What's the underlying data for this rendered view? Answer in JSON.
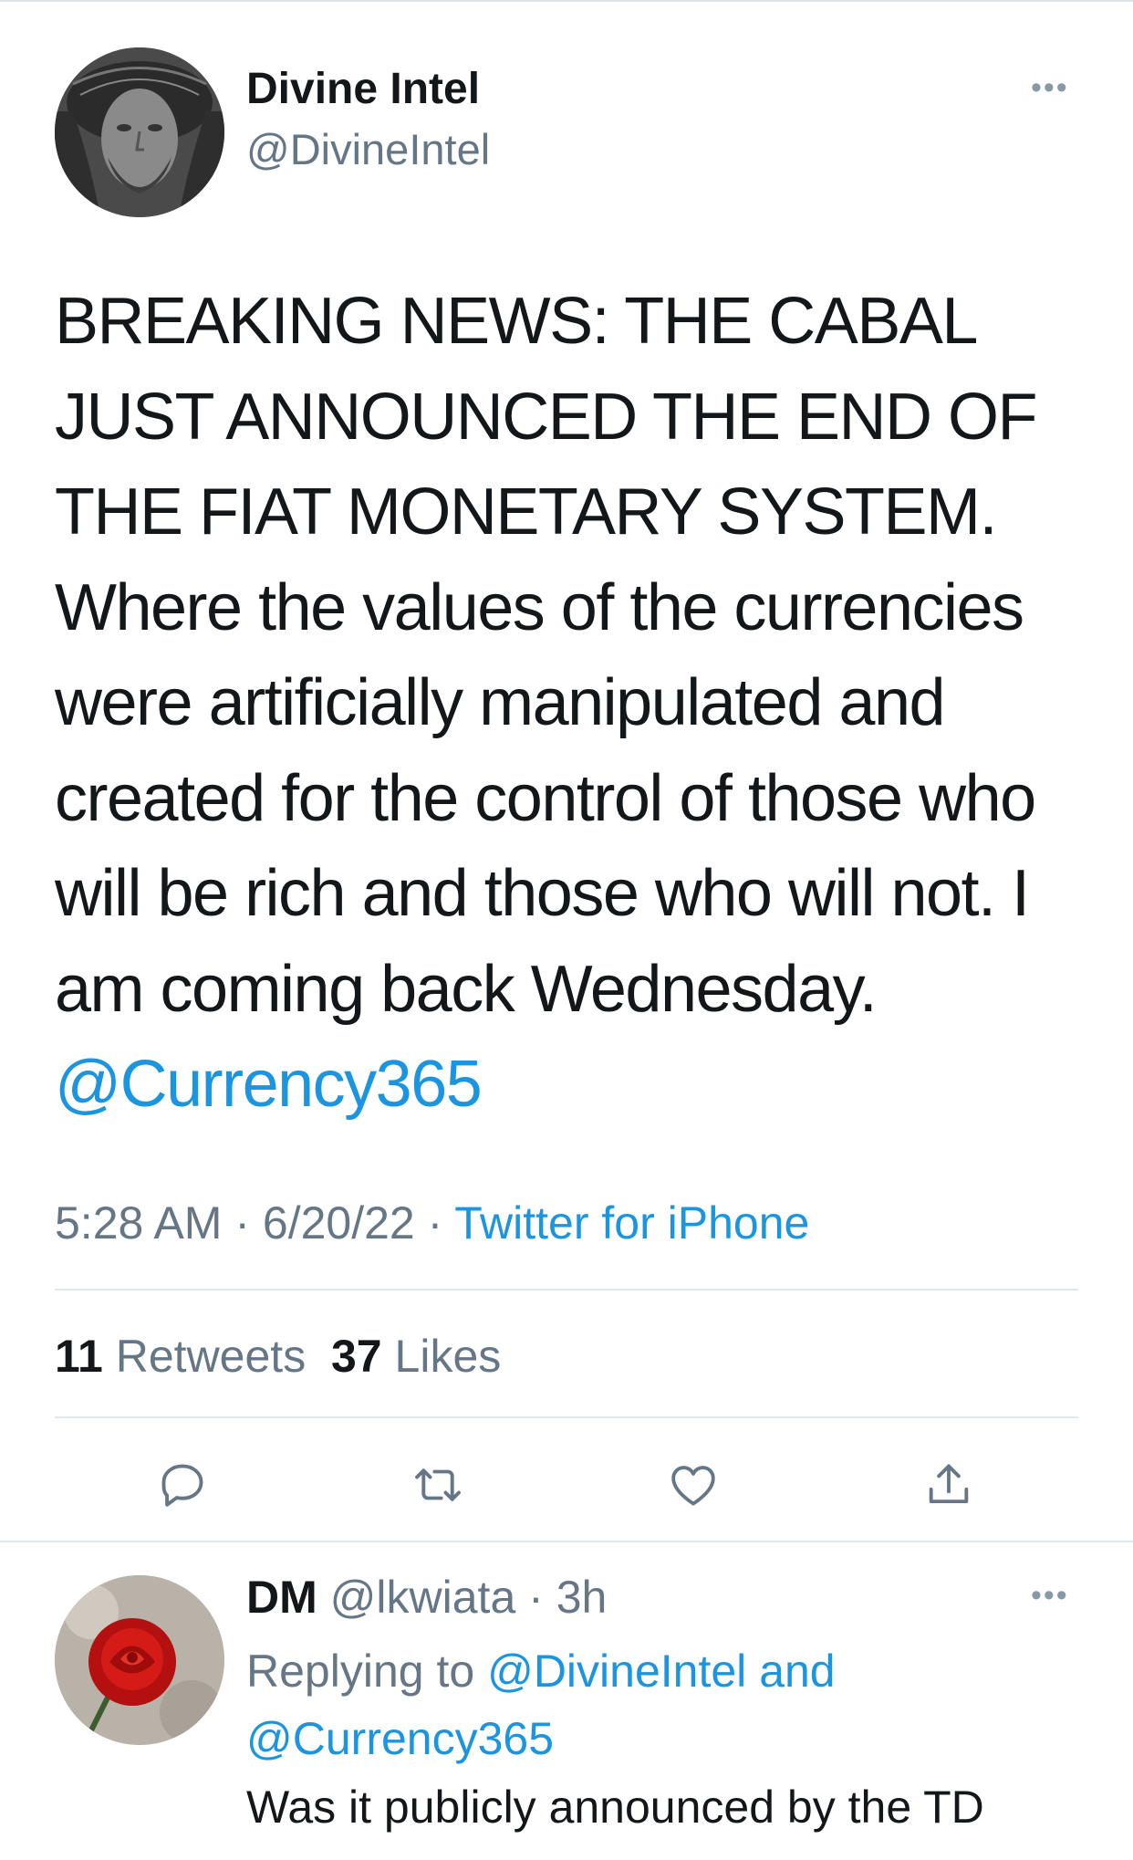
{
  "tweet": {
    "display_name": "Divine Intel",
    "handle": "@DivineIntel",
    "more_icon": "more-dots-icon",
    "text": "BREAKING NEWS: THE CABAL\nJUST ANNOUNCED THE END OF\nTHE FIAT MONETARY SYSTEM.\n Where the values of the currencies\nwere artificially manipulated and\ncreated for the control of those who\nwill be rich and those who will not. I\nam coming back Wednesday.",
    "mention": "@Currency365",
    "time": "5:28 AM",
    "date": "6/20/22",
    "source": "Twitter for iPhone",
    "retweets_count": "11",
    "retweets_label": "Retweets",
    "likes_count": "37",
    "likes_label": "Likes",
    "actions": [
      "reply-icon",
      "retweet-icon",
      "like-icon",
      "share-icon"
    ]
  },
  "reply": {
    "name": "DM",
    "handle": "@lkwiata",
    "age": "3h",
    "replying_prefix": "Replying to",
    "replying_to_1": "@DivineIntel",
    "replying_and": "and",
    "replying_to_2": "@Currency365",
    "text": "Was it publicly announced by the TD"
  },
  "colors": {
    "link": "#1b95e0",
    "secondary_text": "#657786",
    "primary_text": "#14171a",
    "divider": "#e1e8ed"
  }
}
